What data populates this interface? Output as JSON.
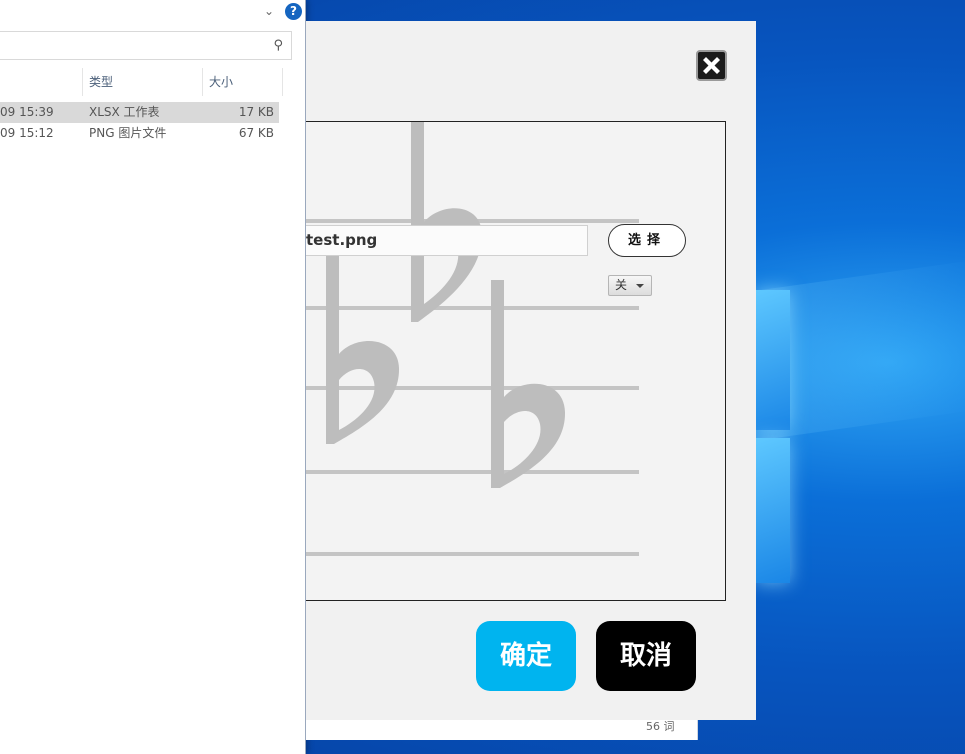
{
  "explorer": {
    "columns": [
      "类型",
      "大小"
    ],
    "files": [
      {
        "modified": "09 15:39",
        "type": "XLSX 工作表",
        "size": "17 KB",
        "selected": true
      },
      {
        "modified": "09 15:12",
        "type": "PNG 图片文件",
        "size": "67 KB",
        "selected": false
      }
    ],
    "help_label": "?"
  },
  "dialog": {
    "file_name": "test.png",
    "select_label": "选择",
    "dropdown_value": "关",
    "ok_label": "确定",
    "cancel_label": "取消"
  },
  "statusbar": {
    "word_count": "56 词"
  },
  "colors": {
    "ok_button": "#00b4ef",
    "cancel_button": "#000000",
    "dialog_bg": "#f1f1f1",
    "desktop": "#0755bf"
  },
  "icons": [
    "close-icon",
    "search-icon",
    "help-icon",
    "chevron-down-icon",
    "music-flat-logo"
  ]
}
